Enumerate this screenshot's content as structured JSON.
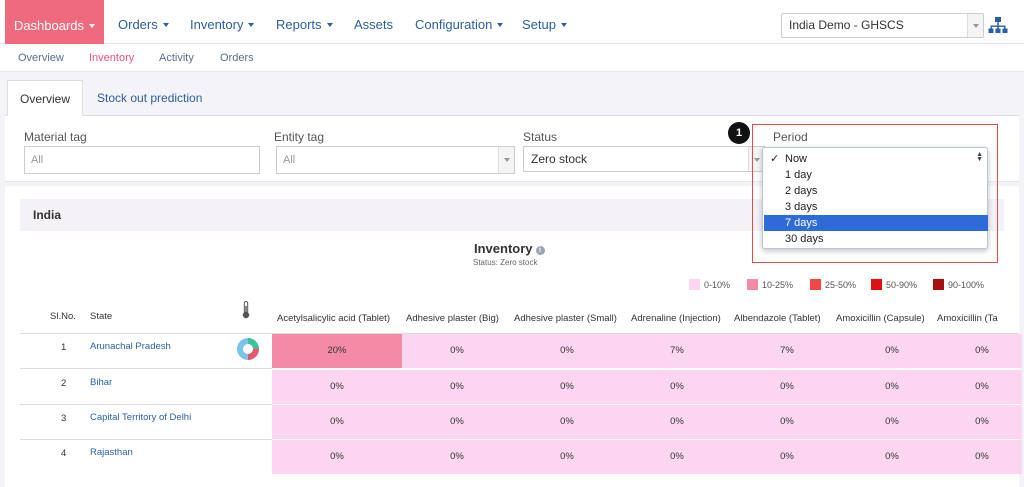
{
  "nav": {
    "items": [
      {
        "label": "Dashboards"
      },
      {
        "label": "Orders"
      },
      {
        "label": "Inventory"
      },
      {
        "label": "Reports"
      },
      {
        "label": "Assets"
      },
      {
        "label": "Configuration"
      },
      {
        "label": "Setup"
      }
    ],
    "domain_select": "India Demo - GHSCS"
  },
  "subnav": {
    "items": [
      {
        "label": "Overview"
      },
      {
        "label": "Inventory"
      },
      {
        "label": "Activity"
      },
      {
        "label": "Orders"
      }
    ]
  },
  "tabs": [
    {
      "label": "Overview"
    },
    {
      "label": "Stock out prediction"
    }
  ],
  "filters": {
    "material_tag": {
      "label": "Material tag",
      "placeholder": "All"
    },
    "entity_tag": {
      "label": "Entity tag",
      "placeholder": "All"
    },
    "status": {
      "label": "Status",
      "value": "Zero stock"
    },
    "period": {
      "label": "Period"
    }
  },
  "period_dropdown": {
    "badge": "1",
    "options": [
      {
        "label": "Now",
        "checked": true
      },
      {
        "label": "1 day"
      },
      {
        "label": "2 days"
      },
      {
        "label": "3 days"
      },
      {
        "label": "7 days",
        "selected": true
      },
      {
        "label": "30 days"
      }
    ]
  },
  "region": {
    "title": "India"
  },
  "inventory": {
    "title": "Inventory",
    "status_line": "Status: Zero stock",
    "legend": [
      {
        "label": "0-10%",
        "color": "#fcd6f0"
      },
      {
        "label": "10-25%",
        "color": "#f48aa6"
      },
      {
        "label": "25-50%",
        "color": "#f04848"
      },
      {
        "label": "50-90%",
        "color": "#dd1111"
      },
      {
        "label": "90-100%",
        "color": "#a50f0f"
      }
    ],
    "headers": {
      "sl_no": "Sl.No.",
      "state": "State",
      "materials": [
        "Acetylsalicylic acid (Tablet)",
        "Adhesive plaster (Big)",
        "Adhesive plaster (Small)",
        "Adrenaline (Injection)",
        "Albendazole (Tablet)",
        "Amoxicillin (Capsule)",
        "Amoxicillin (Ta"
      ]
    },
    "rows": [
      {
        "sl": "1",
        "state": "Arunachal Pradesh",
        "values": [
          "20%",
          "0%",
          "0%",
          "7%",
          "7%",
          "0%",
          "0%"
        ],
        "bins": [
          1,
          0,
          0,
          0,
          0,
          0,
          0
        ]
      },
      {
        "sl": "2",
        "state": "Bihar",
        "values": [
          "0%",
          "0%",
          "0%",
          "0%",
          "0%",
          "0%",
          "0%"
        ],
        "bins": [
          0,
          0,
          0,
          0,
          0,
          0,
          0
        ]
      },
      {
        "sl": "3",
        "state": "Capital Territory of Delhi",
        "values": [
          "0%",
          "0%",
          "0%",
          "0%",
          "0%",
          "0%",
          "0%"
        ],
        "bins": [
          0,
          0,
          0,
          0,
          0,
          0,
          0
        ]
      },
      {
        "sl": "4",
        "state": "Rajasthan",
        "values": [
          "0%",
          "0%",
          "0%",
          "0%",
          "0%",
          "0%",
          "0%"
        ],
        "bins": [
          0,
          0,
          0,
          0,
          0,
          0,
          0
        ]
      }
    ]
  }
}
